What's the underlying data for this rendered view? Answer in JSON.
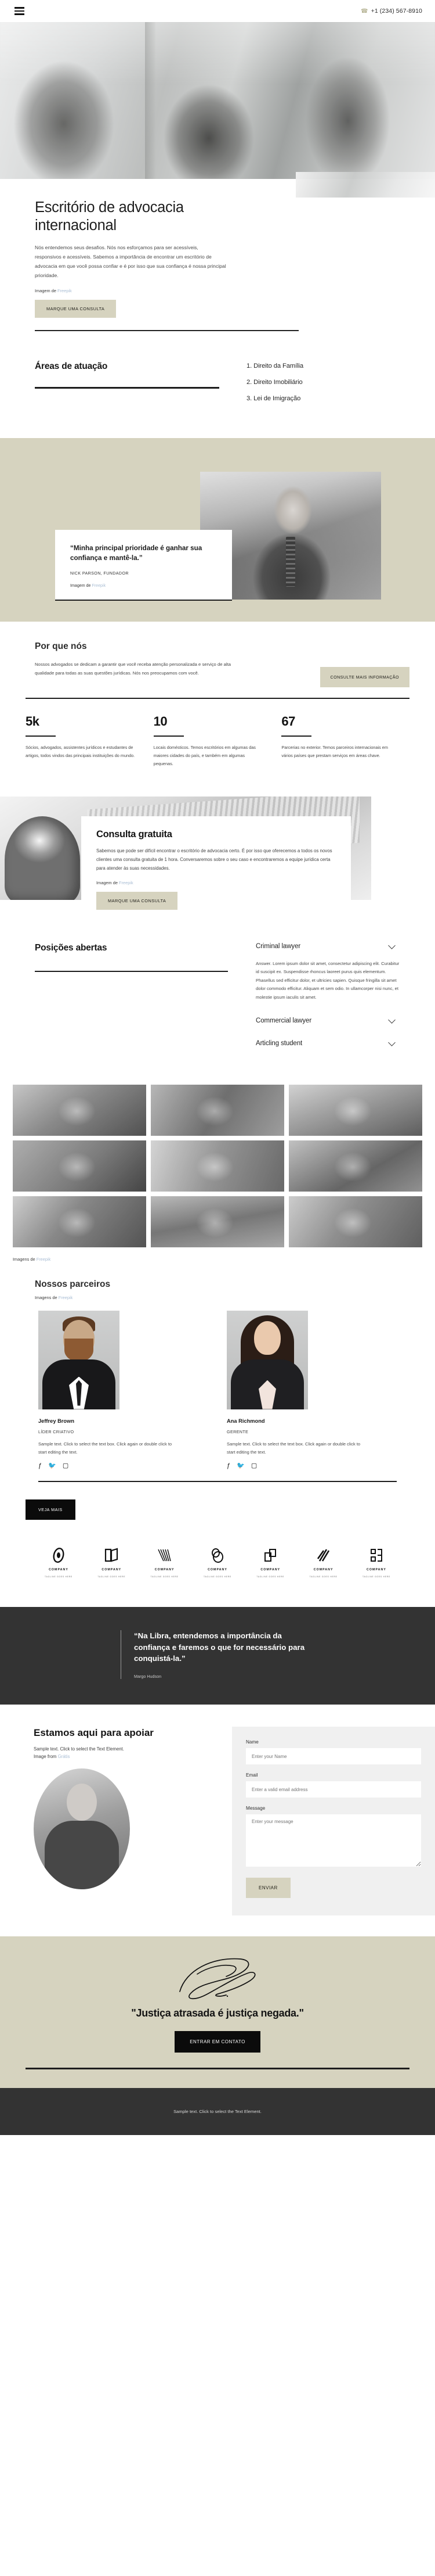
{
  "header": {
    "menu_icon": "hamburger-icon",
    "phone_icon": "phone-icon",
    "phone": "+1 (234) 567-8910"
  },
  "hero": {
    "title": "Escritório de advocacia internacional",
    "text": "Nós entendemos seus desafios. Nós nos esforçamos para ser acessíveis, responsivos e acessíveis. Sabemos a importância de encontrar um escritório de advocacia em que você possa confiar e é por isso que sua confiança é nossa principal prioridade.",
    "credit_prefix": "Imagem de ",
    "credit_link": "Freepik",
    "cta": "MARQUE UMA CONSULTA"
  },
  "areas": {
    "title": "Áreas de atuação",
    "items": [
      "1. Direito da Família",
      "2. Direito Imobiliário",
      "3. Lei de Imigração"
    ]
  },
  "testimonial": {
    "quote": "“Minha principal prioridade é ganhar sua confiança e mantê-la.”",
    "author": "NICK PARSON, FUNDADOR",
    "credit_prefix": "Imagem de ",
    "credit_link": "Freepik"
  },
  "why": {
    "title": "Por que nós",
    "text": "Nossos advogados se dedicam a garantir que você receba atenção personalizada e serviço de alta qualidade para todas as suas questões jurídicas. Nós nos preocupamos com você.",
    "cta": "CONSULTE MAIS INFORMAÇÃO",
    "stats": [
      {
        "num": "5k",
        "desc": "Sócios, advogados, assistentes jurídicos e estudantes de artigos, todos vindos das principais instituições do mundo."
      },
      {
        "num": "10",
        "desc": "Locais domésticos. Temos escritórios em algumas das maiores cidades do país, e também em algumas pequenas."
      },
      {
        "num": "67",
        "desc": "Parcerias no exterior. Temos parceiros internacionais em vários países que prestam serviços em áreas chave."
      }
    ]
  },
  "consult": {
    "title": "Consulta gratuita",
    "text": "Sabemos que pode ser difícil encontrar o escritório de advocacia certo. É por isso que oferecemos a todos os novos clientes uma consulta gratuita de 1 hora. Conversaremos sobre o seu caso e encontraremos a equipe jurídica certa para atender às suas necessidades.",
    "credit_prefix": "Imagem de ",
    "credit_link": "Freepik",
    "cta": "MARQUE UMA CONSULTA"
  },
  "positions": {
    "title": "Posições abertas",
    "items": [
      {
        "label": "Criminal lawyer",
        "body": "Answer. Lorem ipsum dolor sit amet, consectetur adipiscing elit. Curabitur id suscipit ex. Suspendisse rhoncus laoreet purus quis elementum. Phasellus sed efficitur dolor, et ultricies sapien. Quisque fringilla sit amet dolor commodo efficitur. Aliquam et sem odio. In ullamcorper nisi nunc, et molestie ipsum iaculis sit amet.",
        "expanded": true
      },
      {
        "label": "Commercial lawyer",
        "body": "",
        "expanded": false
      },
      {
        "label": "Articling student",
        "body": "",
        "expanded": false
      }
    ]
  },
  "gallery": {
    "credit_prefix": "Imagens de ",
    "credit_link": "Freepik"
  },
  "partners": {
    "title": "Nossos parceiros",
    "sub_prefix": "Imagens de ",
    "sub_link": "Freepik",
    "members": [
      {
        "name": "Jeffrey Brown",
        "role": "LÍDER CRIATIVO",
        "bio": "Sample text. Click to select the text box. Click again or double click to start editing the text.",
        "socials": [
          "facebook-icon",
          "twitter-icon",
          "instagram-icon"
        ]
      },
      {
        "name": "Ana Richmond",
        "role": "GERENTE",
        "bio": "Sample text. Click to select the text box. Click again or double click to start editing the text.",
        "socials": [
          "facebook-icon",
          "twitter-icon",
          "instagram-icon"
        ]
      }
    ],
    "cta": "VEJA MAIS"
  },
  "logos": [
    {
      "name": "COMPANY",
      "tag": "TAGLINE GOES HERE"
    },
    {
      "name": "COMPANY",
      "tag": "TAGLINE GOES HERE"
    },
    {
      "name": "COMPANY",
      "tag": "TAGLINE GOES HERE"
    },
    {
      "name": "COMPANY",
      "tag": "TAGLINE GOES HERE"
    },
    {
      "name": "COMPANY",
      "tag": "TAGLINE GOES HERE"
    },
    {
      "name": "COMPANY",
      "tag": "TAGLINE GOES HERE"
    },
    {
      "name": "COMPANY",
      "tag": "TAGLINE GOES HERE"
    }
  ],
  "dark_quote": {
    "text": "“Na Libra, entendemos a importância da confiança e faremos o que for necessário para conquistá-la.”",
    "author": "Margo Hudson"
  },
  "contact": {
    "title": "Estamos aqui para apoiar",
    "text": "Sample text. Click to select the Text Element.",
    "image_from_prefix": "Image from ",
    "image_from_link": "Grátis",
    "form": {
      "name_label": "Name",
      "name_placeholder": "Enter your Name",
      "name_value": "",
      "email_label": "Email",
      "email_placeholder": "Enter a valid email address",
      "email_value": "",
      "message_label": "Message",
      "message_placeholder": "Enter your message",
      "message_value": "",
      "submit": "ENVIAR"
    }
  },
  "signature": {
    "quote": "\"Justiça atrasada é justiça negada.\"",
    "cta": "ENTRAR EM CONTATO"
  },
  "footer": {
    "text": "Sample text. Click to select the Text Element."
  },
  "colors": {
    "beige": "#d6d3bf",
    "dark": "#333333",
    "black": "#0b0b0b",
    "link": "#a9bdd4"
  }
}
